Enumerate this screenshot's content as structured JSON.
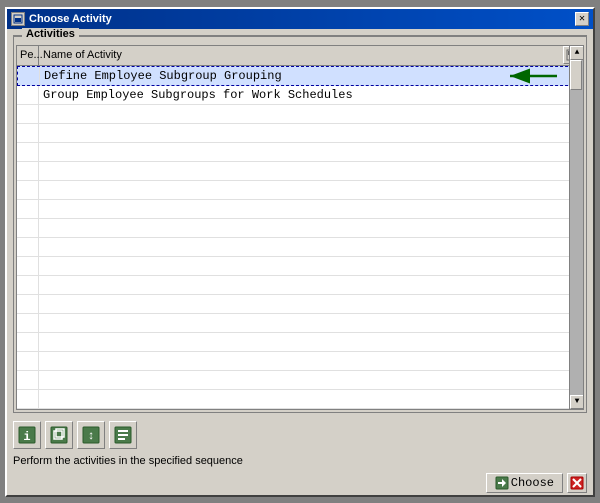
{
  "window": {
    "title": "Choose Activity",
    "close_label": "✕"
  },
  "group": {
    "label": "Activities"
  },
  "table": {
    "columns": [
      {
        "id": "pe",
        "label": "Pe..."
      },
      {
        "id": "name",
        "label": "Name of Activity"
      }
    ],
    "rows": [
      {
        "pe": "",
        "name": "Define Employee Subgroup Grouping",
        "selected": true
      },
      {
        "pe": "",
        "name": "Group Employee Subgroups for Work Schedules",
        "selected": false
      },
      {
        "pe": "",
        "name": "",
        "selected": false
      },
      {
        "pe": "",
        "name": "",
        "selected": false
      },
      {
        "pe": "",
        "name": "",
        "selected": false
      },
      {
        "pe": "",
        "name": "",
        "selected": false
      },
      {
        "pe": "",
        "name": "",
        "selected": false
      },
      {
        "pe": "",
        "name": "",
        "selected": false
      },
      {
        "pe": "",
        "name": "",
        "selected": false
      },
      {
        "pe": "",
        "name": "",
        "selected": false
      },
      {
        "pe": "",
        "name": "",
        "selected": false
      },
      {
        "pe": "",
        "name": "",
        "selected": false
      },
      {
        "pe": "",
        "name": "",
        "selected": false
      },
      {
        "pe": "",
        "name": "",
        "selected": false
      },
      {
        "pe": "",
        "name": "",
        "selected": false
      },
      {
        "pe": "",
        "name": "",
        "selected": false
      },
      {
        "pe": "",
        "name": "",
        "selected": false
      },
      {
        "pe": "",
        "name": "",
        "selected": false
      }
    ]
  },
  "toolbar": {
    "buttons": [
      {
        "name": "info-icon",
        "symbol": "ℹ"
      },
      {
        "name": "copy-icon",
        "symbol": "⧉"
      },
      {
        "name": "expand-icon",
        "symbol": "↕"
      },
      {
        "name": "notes-icon",
        "symbol": "📋"
      }
    ]
  },
  "status": {
    "text": "Perform the activities in the specified sequence"
  },
  "actions": {
    "choose_label": "Choose",
    "cancel_symbol": "✕"
  }
}
